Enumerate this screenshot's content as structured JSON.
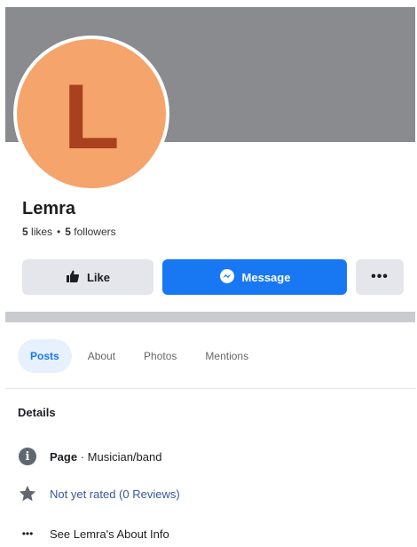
{
  "profile": {
    "avatar_letter": "L",
    "name": "Lemra",
    "likes_count": "5",
    "likes_label": "likes",
    "followers_count": "5",
    "followers_label": "followers",
    "separator": "•"
  },
  "actions": {
    "like_label": "Like",
    "message_label": "Message",
    "more_label": "•••"
  },
  "tabs": [
    {
      "label": "Posts",
      "active": true
    },
    {
      "label": "About",
      "active": false
    },
    {
      "label": "Photos",
      "active": false
    },
    {
      "label": "Mentions",
      "active": false
    }
  ],
  "details": {
    "title": "Details",
    "page_prefix": "Page",
    "page_category": " · Musician/band",
    "rating_text": "Not yet rated (0 Reviews)",
    "about_text": "See Lemra's About Info",
    "about_icon_text": "•••"
  },
  "colors": {
    "cover": "#898b8f",
    "avatar_bg": "#f5a46b",
    "avatar_letter": "#a9411e",
    "accent": "#1877f2"
  },
  "icons": {
    "like": "thumbs-up-icon",
    "message": "messenger-icon",
    "info": "info-icon",
    "rating": "star-icon",
    "about": "more-dots-icon"
  }
}
